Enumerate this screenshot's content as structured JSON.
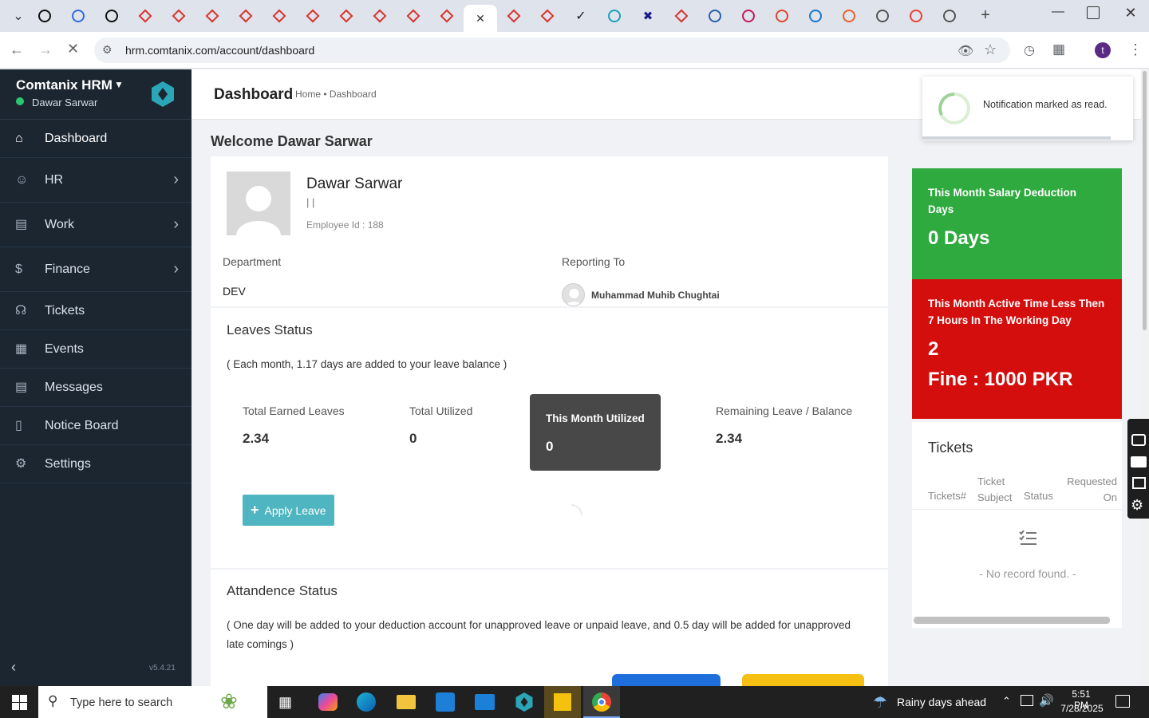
{
  "browser": {
    "tabs": [
      {
        "icon": "chevron-down-icon"
      },
      {
        "icon": "github-icon"
      },
      {
        "icon": "wifi-icon"
      },
      {
        "icon": "openai-icon"
      },
      {
        "icon": "red-diamond-icon"
      },
      {
        "icon": "red-diamond-icon"
      },
      {
        "icon": "red-diamond-icon"
      },
      {
        "icon": "red-diamond-icon"
      },
      {
        "icon": "red-diamond-icon"
      },
      {
        "icon": "red-diamond-icon"
      },
      {
        "icon": "red-diamond-icon"
      },
      {
        "icon": "red-diamond-icon"
      },
      {
        "icon": "red-diamond-icon"
      },
      {
        "icon": "red-diamond-icon"
      },
      {
        "icon": "close-icon",
        "active": true
      },
      {
        "icon": "red-diamond-icon"
      },
      {
        "icon": "red-diamond-icon"
      },
      {
        "icon": "v-icon"
      },
      {
        "icon": "teal-circle-icon"
      },
      {
        "icon": "x-icon"
      },
      {
        "icon": "red-diamond-icon"
      },
      {
        "icon": "scale-icon"
      },
      {
        "icon": "pink-icon"
      },
      {
        "icon": "pen-icon"
      },
      {
        "icon": "pulse-icon"
      },
      {
        "icon": "slash-icon"
      },
      {
        "icon": "globe-icon"
      },
      {
        "icon": "gmail-icon"
      },
      {
        "icon": "globe-icon"
      }
    ],
    "new_tab": "+",
    "url": "hrm.comtanix.com/account/dashboard"
  },
  "sidebar": {
    "brand": "Comtanix HRM",
    "user": "Dawar Sarwar",
    "version": "v5.4.21",
    "items": [
      {
        "label": "Dashboard",
        "icon": "home-icon",
        "chevron": false
      },
      {
        "label": "HR",
        "icon": "users-icon",
        "chevron": true
      },
      {
        "label": "Work",
        "icon": "briefcase-icon",
        "chevron": true
      },
      {
        "label": "Finance",
        "icon": "dollar-icon",
        "chevron": true
      },
      {
        "label": "Tickets",
        "icon": "headset-icon",
        "chevron": false
      },
      {
        "label": "Events",
        "icon": "calendar-icon",
        "chevron": false
      },
      {
        "label": "Messages",
        "icon": "message-icon",
        "chevron": false
      },
      {
        "label": "Notice Board",
        "icon": "clipboard-icon",
        "chevron": false
      },
      {
        "label": "Settings",
        "icon": "gear-icon",
        "chevron": false
      }
    ]
  },
  "header": {
    "title": "Dashboard",
    "crumb_home": "Home",
    "crumb_sep": "•",
    "crumb_current": "Dashboard"
  },
  "toast": {
    "text": "Notification marked as read."
  },
  "welcome": "Welcome Dawar Sarwar",
  "profile": {
    "name": "Dawar Sarwar",
    "pipes": "| |",
    "employee_id": "Employee Id : 188",
    "department_label": "Department",
    "department": "DEV",
    "reporting_label": "Reporting To",
    "reporting_to": "Muhammad Muhib Chughtai"
  },
  "leaves": {
    "title": "Leaves Status",
    "note": "( Each month, 1.17 days are added to your leave balance )",
    "stats": [
      {
        "label": "Total Earned Leaves",
        "value": "2.34"
      },
      {
        "label": "Total Utilized",
        "value": "0"
      },
      {
        "label": "This Month Utilized",
        "value": "0"
      },
      {
        "label": "Remaining Leave / Balance",
        "value": "2.34"
      }
    ],
    "apply_button": "Apply Leave"
  },
  "attendance": {
    "title": "Attandence Status",
    "note": "( One day will be added to your deduction account for unapproved leave or unpaid leave, and 0.5 day will be added for unapproved late comings )"
  },
  "salary_card": {
    "title": "This Month Salary Deduction Days",
    "value": "0 Days",
    "color": "#2eaa3f"
  },
  "active_card": {
    "title": "This Month Active Time Less Then 7 Hours In The Working Day",
    "count": "2",
    "fine": "Fine : 1000 PKR",
    "color": "#d40d0d"
  },
  "tickets": {
    "title": "Tickets",
    "columns": [
      "Tickets#",
      "Ticket Subject",
      "Status",
      "Requested On"
    ],
    "empty": "- No record found. -"
  },
  "taskbar": {
    "search_placeholder": "Type here to search",
    "weather": "Rainy days ahead",
    "time": "5:51 PM",
    "date": "7/28/2025"
  }
}
